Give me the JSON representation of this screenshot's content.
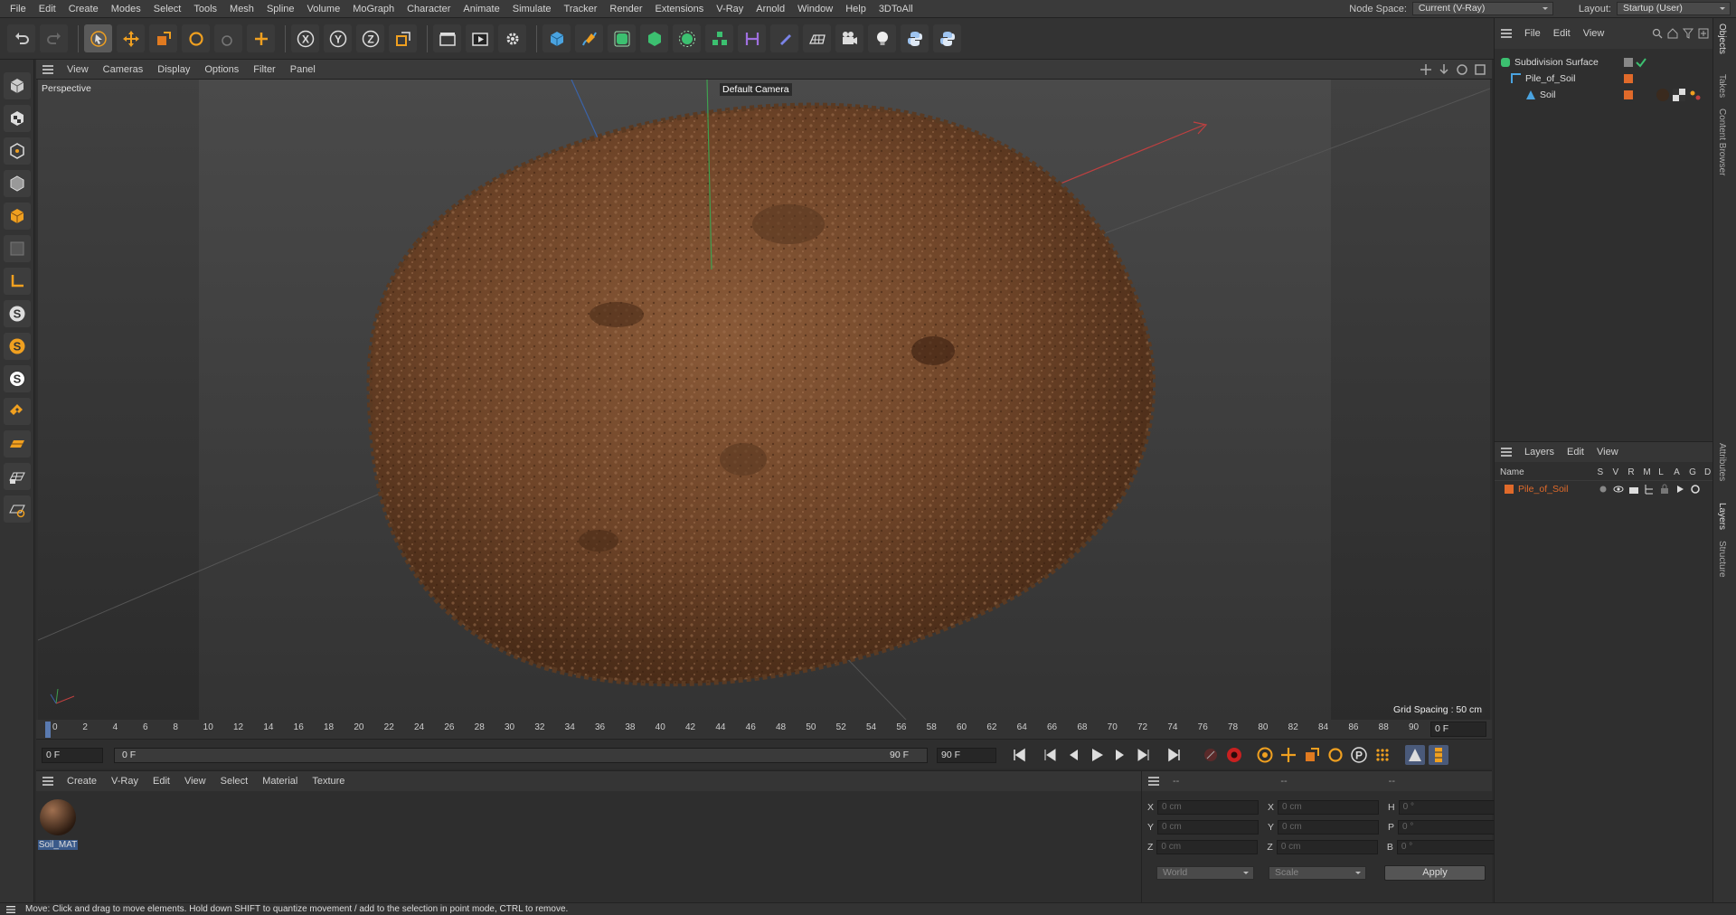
{
  "menu": {
    "items": [
      "File",
      "Edit",
      "Create",
      "Modes",
      "Select",
      "Tools",
      "Mesh",
      "Spline",
      "Volume",
      "MoGraph",
      "Character",
      "Animate",
      "Simulate",
      "Tracker",
      "Render",
      "Extensions",
      "V-Ray",
      "Arnold",
      "Window",
      "Help",
      "3DToAll"
    ],
    "node_space_label": "Node Space:",
    "node_space_value": "Current (V-Ray)",
    "layout_label": "Layout:",
    "layout_value": "Startup (User)"
  },
  "toolbar": {
    "x_label": "X",
    "y_label": "Y",
    "z_label": "Z"
  },
  "viewport": {
    "menu": [
      "View",
      "Cameras",
      "Display",
      "Options",
      "Filter",
      "Panel"
    ],
    "view_name": "Perspective",
    "camera": "Default Camera",
    "grid_spacing": "Grid Spacing : 50 cm"
  },
  "timeline": {
    "ticks": [
      "0",
      "2",
      "4",
      "6",
      "8",
      "10",
      "12",
      "14",
      "16",
      "18",
      "20",
      "22",
      "24",
      "26",
      "28",
      "30",
      "32",
      "34",
      "36",
      "38",
      "40",
      "42",
      "44",
      "46",
      "48",
      "50",
      "52",
      "54",
      "56",
      "58",
      "60",
      "62",
      "64",
      "66",
      "68",
      "70",
      "72",
      "74",
      "76",
      "78",
      "80",
      "82",
      "84",
      "86",
      "88",
      "90"
    ],
    "current_frame": "0 F",
    "start_frame": "0 F",
    "range_start": "0 F",
    "range_end": "90 F",
    "end_frame": "90 F"
  },
  "materials": {
    "menu": [
      "Create",
      "V-Ray",
      "Edit",
      "View",
      "Select",
      "Material",
      "Texture"
    ],
    "items": [
      {
        "name": "Soil_MAT"
      }
    ]
  },
  "coords": {
    "headers": [
      "--",
      "--",
      "--"
    ],
    "pos_x": "0 cm",
    "pos_y": "0 cm",
    "pos_z": "0 cm",
    "size_x": "0 cm",
    "size_y": "0 cm",
    "size_z": "0 cm",
    "rot_h": "0 °",
    "rot_p": "0 °",
    "rot_b": "0 °",
    "mode": "World",
    "size_mode": "Scale",
    "apply": "Apply",
    "labels": {
      "x": "X",
      "y": "Y",
      "z": "Z",
      "h": "H",
      "p": "P",
      "b": "B"
    }
  },
  "objects": {
    "menu": [
      "File",
      "Edit",
      "View"
    ],
    "items": [
      {
        "name": "Subdivision Surface"
      },
      {
        "name": "Pile_of_Soil"
      },
      {
        "name": "Soil"
      }
    ]
  },
  "layers": {
    "menu": [
      "Layers",
      "Edit",
      "View"
    ],
    "columns": [
      "Name",
      "S",
      "V",
      "R",
      "M",
      "L",
      "A",
      "G",
      "D"
    ],
    "items": [
      {
        "name": "Pile_of_Soil",
        "color": "#e06a2a"
      }
    ]
  },
  "sidetabs": [
    "Objects",
    "Takes",
    "Content Browser",
    "Attributes",
    "Layers",
    "Structure"
  ],
  "status": "Move: Click and drag to move elements. Hold down SHIFT to quantize movement / add to the selection in point mode, CTRL to remove."
}
